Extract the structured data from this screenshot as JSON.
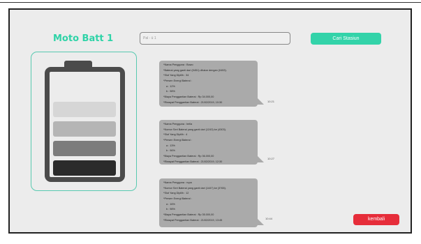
{
  "app": {
    "title": "Moto Batt 1",
    "accent_color": "#2ed3a7",
    "danger_color": "#e62d3a"
  },
  "search": {
    "placeholder": "Pal - ü 1"
  },
  "buttons": {
    "find_station": "Cari Stasiun",
    "back": "kembali"
  },
  "battery": {
    "icon": "battery-icon",
    "cells": 4
  },
  "messages": [
    {
      "rows": [
        "*Nama Pengguna : Bowo",
        "*Baterai yang ganti dari (0451) ditukar dengan (0453).",
        "*Slot Yang Dipilih : 34"
      ],
      "charge_label": "*Persen Energi Baterai :",
      "charge_rows": [
        "a : 12%",
        "b : 98%"
      ],
      "cost": "*Biaya Penggantian Baterai : Rp 34.000,00",
      "history": "*Riwayat Penggantian Baterai : 21/02/2019, 10:30",
      "time": "10:21"
    },
    {
      "rows": [
        "*Nama Pengguna : bella",
        "*Nomor Seri Baterai yang ganti dari (1243) ke (4303).",
        "*Slot Yang Dipilih : 4"
      ],
      "charge_label": "*Persen Energi Baterai :",
      "charge_rows": [
        "a : 13%",
        "b : 96%"
      ],
      "cost": "*Biaya Penggantian Baterai : Rp 36.000,00",
      "history": "*Riwayat Penggantian Baterai : 21/02/2019, 12:30",
      "time": "10:27"
    },
    {
      "rows": [
        "*Nama Pengguna : rupa",
        "*Nomor Seri Baterai yang ganti dari (1447) ke (3765).",
        "*Slot Yang Dipilih : 12"
      ],
      "charge_label": "*Persen Energi Baterai :",
      "charge_rows": [
        "a : 16%",
        "b : 98%"
      ],
      "cost": "*Biaya Penggantian Baterai : Rp 35.000,00",
      "history": "*Riwayat Penggantian Baterai : 21/02/2019, 13:45",
      "time": "10:44"
    }
  ]
}
